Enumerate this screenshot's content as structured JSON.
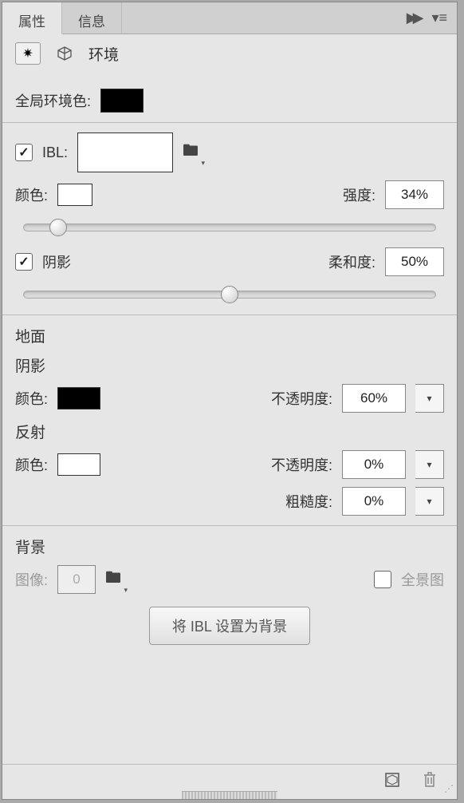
{
  "tabs": {
    "active": "属性",
    "inactive": "信息"
  },
  "header": {
    "title": "环境"
  },
  "globalEnv": {
    "label": "全局环境色:"
  },
  "ibl": {
    "checked": true,
    "label": "IBL:",
    "colorLabel": "颜色:",
    "intensityLabel": "强度:",
    "intensityValue": "34%",
    "shadowChecked": true,
    "shadowLabel": "阴影",
    "softnessLabel": "柔和度:",
    "softnessValue": "50%"
  },
  "ground": {
    "heading": "地面",
    "shadowHeading": "阴影",
    "colorLabel": "颜色:",
    "opacityLabel": "不透明度:",
    "shadowOpacity": "60%",
    "reflectHeading": "反射",
    "reflectOpacity": "0%",
    "roughnessLabel": "粗糙度:",
    "roughness": "0%"
  },
  "background": {
    "heading": "背景",
    "imageLabel": "图像:",
    "imageValue": "0",
    "panoramaLabel": "全景图",
    "setIblButton": "将 IBL 设置为背景"
  },
  "sliders": {
    "intensityPos": 10,
    "softnessPos": 50
  }
}
